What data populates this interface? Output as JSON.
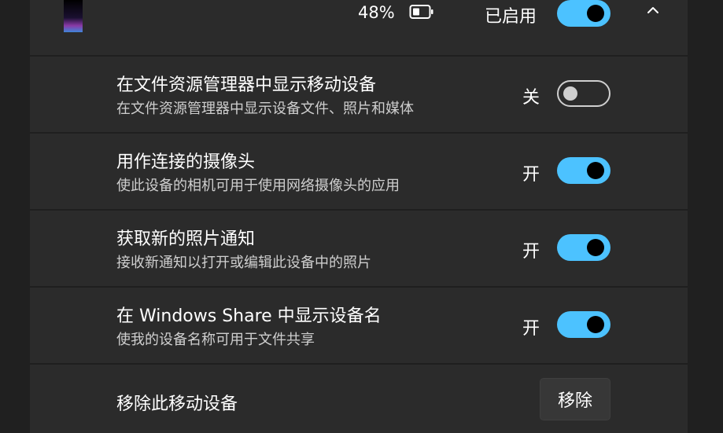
{
  "header": {
    "battery_level": "48%",
    "status_label": "已启用",
    "toggle_on": true
  },
  "rows": [
    {
      "title": "在文件资源管理器中显示移动设备",
      "description": "在文件资源管理器中显示设备文件、照片和媒体",
      "state_label": "关",
      "on": false
    },
    {
      "title": "用作连接的摄像头",
      "description": "使此设备的相机可用于使用网络摄像头的应用",
      "state_label": "开",
      "on": true
    },
    {
      "title": "获取新的照片通知",
      "description": "接收新通知以打开或编辑此设备中的照片",
      "state_label": "开",
      "on": true
    },
    {
      "title": "在 Windows Share 中显示设备名",
      "description": "使我的设备名称可用于文件共享",
      "state_label": "开",
      "on": true
    }
  ],
  "remove": {
    "title": "移除此移动设备",
    "button_label": "移除"
  },
  "colors": {
    "accent": "#4cc2ff",
    "panel": "#2b2b2b",
    "background": "#202020"
  },
  "icons": [
    "battery-icon",
    "chevron-up-icon"
  ]
}
